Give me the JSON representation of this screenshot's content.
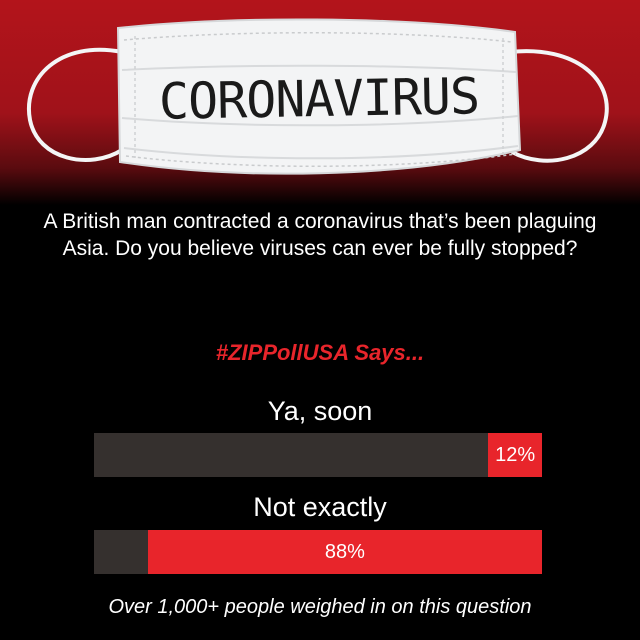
{
  "hero": {
    "mask_text": "CORONAVIRUS",
    "colors": {
      "background": "#b3141b",
      "mask": "#f3f4f5",
      "ink": "#1a1a1a"
    }
  },
  "question": "A British man contracted a coronavirus that’s been plaguing Asia. Do you believe viruses can ever be fully stopped?",
  "hashtag": "#ZIPPollUSA Says...",
  "poll": {
    "options": [
      {
        "label": "Ya, soon",
        "percent": 12,
        "percent_label": "12%"
      },
      {
        "label": "Not exactly",
        "percent": 88,
        "percent_label": "88%"
      }
    ]
  },
  "footer": "Over 1,000+ people weighed in on this question",
  "colors": {
    "accent": "#e8252b",
    "bar_track": "#35302e",
    "background": "#000000",
    "text": "#ffffff"
  }
}
